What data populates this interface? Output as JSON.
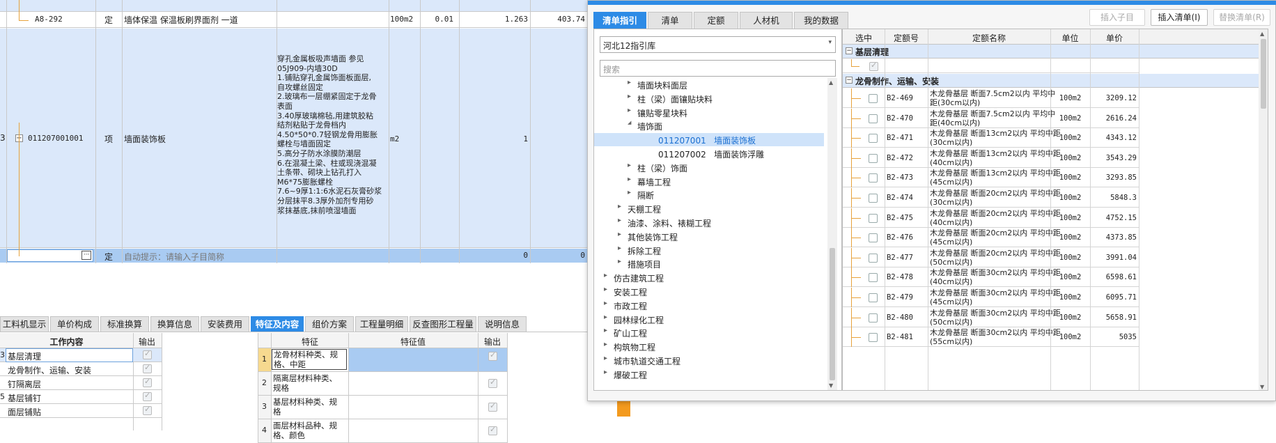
{
  "colors": {
    "accent": "#2d8be6",
    "row_highlight": "#dbe8fa",
    "input_row": "#a9cbf2",
    "tree_line": "#e6a23c",
    "scrollbar": "#f0f0f0"
  },
  "main_table": {
    "row1": {
      "code": "A8-292",
      "type": "定",
      "name": "墙体保温 保温板刷界面剂 一道",
      "unit": "100m2",
      "c1": "0.01",
      "c2": "1.263",
      "c3": "403.74"
    },
    "row2": {
      "seq": "3",
      "code": "011207001001",
      "type": "项",
      "name": "墙面装饰板",
      "feature_lines": [
        "穿孔金属板吸声墙面 参见",
        "05J909-内墙30D",
        "1.铺贴穿孔金属饰面板面层,",
        "自攻螺丝固定",
        "2.玻璃布一层绷紧固定于龙骨",
        "表面",
        "3.40厚玻璃棉毡,用建筑胶粘",
        "结剂粘贴于龙骨档内",
        "4.50*50*0.7轻钢龙骨用膨胀",
        "螺栓与墙面固定",
        "5.高分子防水涂膜防潮层",
        "6.在混凝土梁、柱或现浇混凝",
        "土条带、砌块上钻孔打入",
        "M6*75膨胀螺栓",
        "7.6~9厚1:1:6水泥石灰膏砂浆",
        "分层抹平8.3厚外加剂专用砂",
        "浆抹基底,抹前喷湿墙面"
      ],
      "unit": "m2",
      "c2": "1"
    },
    "row3": {
      "type": "定",
      "hint": "自动提示：请输入子目简称",
      "ellipsis": "···",
      "c2": "0",
      "c3": "0"
    }
  },
  "bottom_tabs": [
    "工料机显示",
    "单价构成",
    "标准换算",
    "换算信息",
    "安装费用",
    "特征及内容",
    "组价方案",
    "工程量明细",
    "反查图形工程量",
    "说明信息"
  ],
  "bottom_active_tab": "特征及内容",
  "work_table": {
    "header_content": "工作内容",
    "header_output": "输出",
    "rows": [
      {
        "text": "基层清理",
        "left_mark": "3"
      },
      {
        "text": "龙骨制作、运输、安装",
        "left_mark": ""
      },
      {
        "text": "钉隔离层",
        "left_mark": ""
      },
      {
        "text": "基层铺钉",
        "left_mark": "5"
      },
      {
        "text": "面层铺贴",
        "left_mark": ""
      }
    ]
  },
  "feature_table": {
    "header_feature": "特征",
    "header_value": "特征值",
    "header_output": "输出",
    "rows": [
      {
        "no": "1",
        "lines": [
          "龙骨材料种类、规",
          "格、中距"
        ]
      },
      {
        "no": "2",
        "lines": [
          "隔离层材料种类、",
          "规格"
        ]
      },
      {
        "no": "3",
        "lines": [
          "基层材料种类、规",
          "格"
        ]
      },
      {
        "no": "4",
        "lines": [
          "面层材料品种、规",
          "格、颜色"
        ]
      }
    ]
  },
  "dialog": {
    "tabs": [
      "清单指引",
      "清单",
      "定额",
      "人材机",
      "我的数据"
    ],
    "active_tab": "清单指引",
    "buttons": {
      "insert_sub": "插入子目",
      "insert_list": "插入清单(I)",
      "replace_list": "替换清单(R)"
    },
    "library": "河北12指引库",
    "search_placeholder": "搜索",
    "tree": [
      {
        "label": "墙面块料面层",
        "arrow": "▸",
        "level": 3
      },
      {
        "label": "柱（梁）面镶贴块料",
        "arrow": "▸",
        "level": 3
      },
      {
        "label": "镶贴零星块料",
        "arrow": "▸",
        "level": 3
      },
      {
        "label": "墙饰面",
        "arrow": "◢",
        "level": 3
      },
      {
        "label": "011207001   墙面装饰板",
        "arrow": "",
        "level": 4,
        "selected": true
      },
      {
        "label": "011207002   墙面装饰浮雕",
        "arrow": "",
        "level": 4
      },
      {
        "label": "柱（梁）饰面",
        "arrow": "▸",
        "level": 3
      },
      {
        "label": "幕墙工程",
        "arrow": "▸",
        "level": 3
      },
      {
        "label": "隔断",
        "arrow": "▸",
        "level": 3
      },
      {
        "label": "天棚工程",
        "arrow": "▸",
        "level": 2
      },
      {
        "label": "油漆、涂料、裱糊工程",
        "arrow": "▸",
        "level": 2
      },
      {
        "label": "其他装饰工程",
        "arrow": "▸",
        "level": 2
      },
      {
        "label": "拆除工程",
        "arrow": "▸",
        "level": 2
      },
      {
        "label": "措施项目",
        "arrow": "▸",
        "level": 2
      },
      {
        "label": "仿古建筑工程",
        "arrow": "▸",
        "level": 1
      },
      {
        "label": "安装工程",
        "arrow": "▸",
        "level": 1
      },
      {
        "label": "市政工程",
        "arrow": "▸",
        "level": 1
      },
      {
        "label": "园林绿化工程",
        "arrow": "▸",
        "level": 1
      },
      {
        "label": "矿山工程",
        "arrow": "▸",
        "level": 1
      },
      {
        "label": "构筑物工程",
        "arrow": "▸",
        "level": 1
      },
      {
        "label": "城市轨道交通工程",
        "arrow": "▸",
        "level": 1
      },
      {
        "label": "爆破工程",
        "arrow": "▸",
        "level": 1
      }
    ],
    "grid": {
      "headers": {
        "select": "选中",
        "code": "定额号",
        "name": "定额名称",
        "unit": "单位",
        "price": "单价"
      },
      "group1": "基层清理",
      "group2": "龙骨制作、运输、安装",
      "rows": [
        {
          "code": "B2-469",
          "l1": "木龙骨基层 断面7.5cm2以内 平均中",
          "l2": "距(30cm以内)",
          "unit": "100m2",
          "price": "3209.12"
        },
        {
          "code": "B2-470",
          "l1": "木龙骨基层 断面7.5cm2以内 平均中",
          "l2": "距(40cm以内)",
          "unit": "100m2",
          "price": "2616.24"
        },
        {
          "code": "B2-471",
          "l1": "木龙骨基层 断面13cm2以内 平均中距",
          "l2": "(30cm以内)",
          "unit": "100m2",
          "price": "4343.12"
        },
        {
          "code": "B2-472",
          "l1": "木龙骨基层 断面13cm2以内 平均中距",
          "l2": "(40cm以内)",
          "unit": "100m2",
          "price": "3543.29"
        },
        {
          "code": "B2-473",
          "l1": "木龙骨基层 断面13cm2以内 平均中距",
          "l2": "(45cm以内)",
          "unit": "100m2",
          "price": "3293.85"
        },
        {
          "code": "B2-474",
          "l1": "木龙骨基层 断面20cm2以内 平均中距",
          "l2": "(30cm以内)",
          "unit": "100m2",
          "price": "5848.3"
        },
        {
          "code": "B2-475",
          "l1": "木龙骨基层 断面20cm2以内 平均中距",
          "l2": "(40cm以内)",
          "unit": "100m2",
          "price": "4752.15"
        },
        {
          "code": "B2-476",
          "l1": "木龙骨基层 断面20cm2以内 平均中距",
          "l2": "(45cm以内)",
          "unit": "100m2",
          "price": "4373.85"
        },
        {
          "code": "B2-477",
          "l1": "木龙骨基层 断面20cm2以内 平均中距",
          "l2": "(50cm以内)",
          "unit": "100m2",
          "price": "3991.04"
        },
        {
          "code": "B2-478",
          "l1": "木龙骨基层 断面30cm2以内 平均中距",
          "l2": "(40cm以内)",
          "unit": "100m2",
          "price": "6598.61"
        },
        {
          "code": "B2-479",
          "l1": "木龙骨基层 断面30cm2以内 平均中距",
          "l2": "(45cm以内)",
          "unit": "100m2",
          "price": "6095.71"
        },
        {
          "code": "B2-480",
          "l1": "木龙骨基层 断面30cm2以内 平均中距",
          "l2": "(50cm以内)",
          "unit": "100m2",
          "price": "5658.91"
        },
        {
          "code": "B2-481",
          "l1": "木龙骨基层 断面30cm2以内 平均中距",
          "l2": "(55cm以内)",
          "unit": "100m2",
          "price": "5035"
        }
      ]
    }
  }
}
